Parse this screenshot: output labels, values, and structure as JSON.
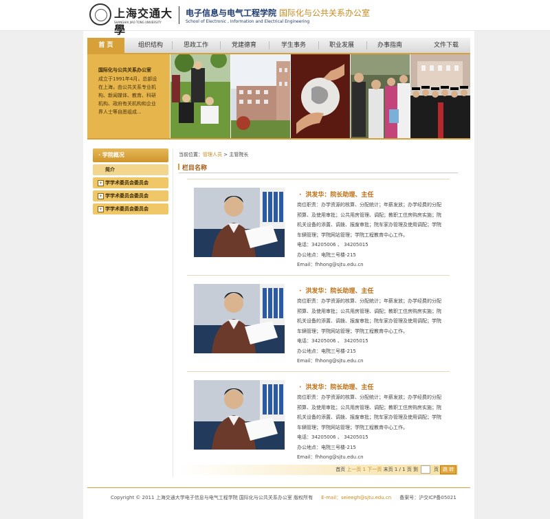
{
  "header": {
    "university_cn": "上海交通大學",
    "university_en": "SHANGHAI JIAO TONG UNIVERSITY",
    "school_cn": "电子信息与电气工程学院",
    "school_en": "School of Electronic , Information and Electrical Engineering",
    "office": "国际化与公共关系办公室"
  },
  "nav": {
    "items": [
      "首 页",
      "组织结构",
      "思政工作",
      "党建德育",
      "学生事务",
      "职业发展",
      "办事指南",
      "文件下载"
    ],
    "active_index": 0
  },
  "banner": {
    "intro_title": "国际化与公共关系办公室",
    "intro_text": "成立于1991年4月，总部设在上海，由公共关系专业机构、新闻媒体、教育、科研机构、政府有关机构和企业界人士等自愿组成..."
  },
  "sidebar": {
    "header": "· 学院概况",
    "sub_item": "简介",
    "categories": [
      "学学术委员会委员会",
      "学学术委员会委员会",
      "学学术委员会委员会"
    ],
    "plus_glyph": "+"
  },
  "breadcrumb": {
    "prefix": "当前位置：",
    "link": "管理人员",
    "separator": " > ",
    "current": "主管院长"
  },
  "column_title": "栏目名称",
  "people": [
    {
      "name": "洪发华：院长助理、主任",
      "duty": "岗位职责：办学资源的核算、分配统计；年薪发放；办学经费的分配预算、及使用审批；公共用房管理、调配；教职工住房购房实施；院机关设备的添置、调拨、报废审批；院车家办管理及使用调配；学院车辆管理；学院网站管理；学院工程教育中心工作。",
      "phone": "电话：34205006 、 34205015",
      "office": "办公地点：电院三号楼-215",
      "email": "Email：fhhong@sjtu.edu.cn"
    },
    {
      "name": "洪发华：院长助理、主任",
      "duty": "岗位职责：办学资源的核算、分配统计；年薪发放；办学经费的分配预算、及使用审批；公共用房管理、调配；教职工住房购房实施；院机关设备的添置、调拨、报废审批；院车家办管理及使用调配；学院车辆管理；学院网站管理；学院工程教育中心工作。",
      "phone": "电话：34205006 、 34205015",
      "office": "办公地点：电院三号楼-215",
      "email": "Email：fhhong@sjtu.edu.cn"
    },
    {
      "name": "洪发华：院长助理、主任",
      "duty": "岗位职责：办学资源的核算、分配统计；年薪发放；办学经费的分配预算、及使用审批；公共用房管理、调配；教职工住房购房实施；院机关设备的添置、调拨、报废审批；院车家办管理及使用调配；学院车辆管理；学院网站管理；学院工程教育中心工作。",
      "phone": "电话：34205006 、 34205015",
      "office": "办公地点：电院三号楼-215",
      "email": "Email：fhhong@sjtu.edu.cn"
    }
  ],
  "pager": {
    "first": "首页",
    "prev": "上一页",
    "page1": "1",
    "next": "下一页",
    "last": "末页",
    "info": "1 / 1 页 到",
    "page_unit": "页",
    "go": "跳 转"
  },
  "footer": {
    "copyright": "Copyright © 2011 上海交通大学电子信息与电气工程学院 国际化与公共关系办公室 版权所有",
    "email": "E-mail：seieegh@sjtu.edu.cn",
    "icp": "备案号：沪交ICP备05021"
  },
  "colors": {
    "accent": "#d8a038",
    "navy": "#1d3a6e",
    "orange_text": "#c06d10"
  }
}
